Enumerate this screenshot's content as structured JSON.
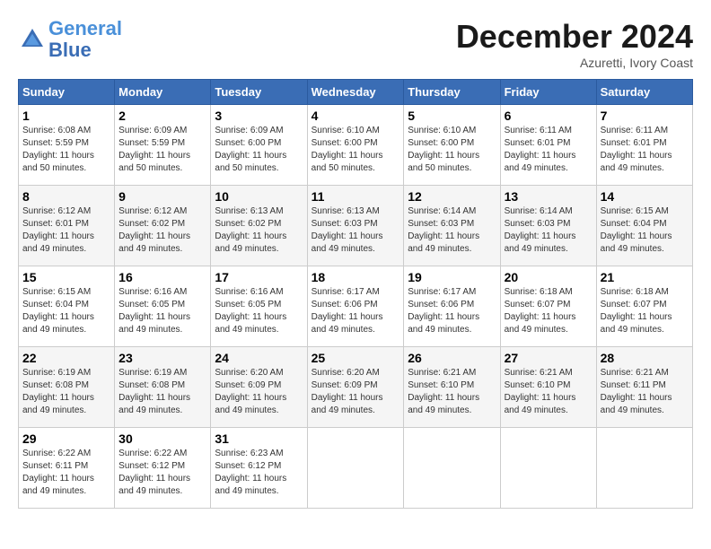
{
  "header": {
    "logo_line1": "General",
    "logo_line2": "Blue",
    "month_title": "December 2024",
    "location": "Azuretti, Ivory Coast"
  },
  "calendar": {
    "weekdays": [
      "Sunday",
      "Monday",
      "Tuesday",
      "Wednesday",
      "Thursday",
      "Friday",
      "Saturday"
    ],
    "weeks": [
      [
        {
          "day": "1",
          "sunrise": "6:08 AM",
          "sunset": "5:59 PM",
          "daylight": "11 hours and 50 minutes."
        },
        {
          "day": "2",
          "sunrise": "6:09 AM",
          "sunset": "5:59 PM",
          "daylight": "11 hours and 50 minutes."
        },
        {
          "day": "3",
          "sunrise": "6:09 AM",
          "sunset": "6:00 PM",
          "daylight": "11 hours and 50 minutes."
        },
        {
          "day": "4",
          "sunrise": "6:10 AM",
          "sunset": "6:00 PM",
          "daylight": "11 hours and 50 minutes."
        },
        {
          "day": "5",
          "sunrise": "6:10 AM",
          "sunset": "6:00 PM",
          "daylight": "11 hours and 50 minutes."
        },
        {
          "day": "6",
          "sunrise": "6:11 AM",
          "sunset": "6:01 PM",
          "daylight": "11 hours and 49 minutes."
        },
        {
          "day": "7",
          "sunrise": "6:11 AM",
          "sunset": "6:01 PM",
          "daylight": "11 hours and 49 minutes."
        }
      ],
      [
        {
          "day": "8",
          "sunrise": "6:12 AM",
          "sunset": "6:01 PM",
          "daylight": "11 hours and 49 minutes."
        },
        {
          "day": "9",
          "sunrise": "6:12 AM",
          "sunset": "6:02 PM",
          "daylight": "11 hours and 49 minutes."
        },
        {
          "day": "10",
          "sunrise": "6:13 AM",
          "sunset": "6:02 PM",
          "daylight": "11 hours and 49 minutes."
        },
        {
          "day": "11",
          "sunrise": "6:13 AM",
          "sunset": "6:03 PM",
          "daylight": "11 hours and 49 minutes."
        },
        {
          "day": "12",
          "sunrise": "6:14 AM",
          "sunset": "6:03 PM",
          "daylight": "11 hours and 49 minutes."
        },
        {
          "day": "13",
          "sunrise": "6:14 AM",
          "sunset": "6:03 PM",
          "daylight": "11 hours and 49 minutes."
        },
        {
          "day": "14",
          "sunrise": "6:15 AM",
          "sunset": "6:04 PM",
          "daylight": "11 hours and 49 minutes."
        }
      ],
      [
        {
          "day": "15",
          "sunrise": "6:15 AM",
          "sunset": "6:04 PM",
          "daylight": "11 hours and 49 minutes."
        },
        {
          "day": "16",
          "sunrise": "6:16 AM",
          "sunset": "6:05 PM",
          "daylight": "11 hours and 49 minutes."
        },
        {
          "day": "17",
          "sunrise": "6:16 AM",
          "sunset": "6:05 PM",
          "daylight": "11 hours and 49 minutes."
        },
        {
          "day": "18",
          "sunrise": "6:17 AM",
          "sunset": "6:06 PM",
          "daylight": "11 hours and 49 minutes."
        },
        {
          "day": "19",
          "sunrise": "6:17 AM",
          "sunset": "6:06 PM",
          "daylight": "11 hours and 49 minutes."
        },
        {
          "day": "20",
          "sunrise": "6:18 AM",
          "sunset": "6:07 PM",
          "daylight": "11 hours and 49 minutes."
        },
        {
          "day": "21",
          "sunrise": "6:18 AM",
          "sunset": "6:07 PM",
          "daylight": "11 hours and 49 minutes."
        }
      ],
      [
        {
          "day": "22",
          "sunrise": "6:19 AM",
          "sunset": "6:08 PM",
          "daylight": "11 hours and 49 minutes."
        },
        {
          "day": "23",
          "sunrise": "6:19 AM",
          "sunset": "6:08 PM",
          "daylight": "11 hours and 49 minutes."
        },
        {
          "day": "24",
          "sunrise": "6:20 AM",
          "sunset": "6:09 PM",
          "daylight": "11 hours and 49 minutes."
        },
        {
          "day": "25",
          "sunrise": "6:20 AM",
          "sunset": "6:09 PM",
          "daylight": "11 hours and 49 minutes."
        },
        {
          "day": "26",
          "sunrise": "6:21 AM",
          "sunset": "6:10 PM",
          "daylight": "11 hours and 49 minutes."
        },
        {
          "day": "27",
          "sunrise": "6:21 AM",
          "sunset": "6:10 PM",
          "daylight": "11 hours and 49 minutes."
        },
        {
          "day": "28",
          "sunrise": "6:21 AM",
          "sunset": "6:11 PM",
          "daylight": "11 hours and 49 minutes."
        }
      ],
      [
        {
          "day": "29",
          "sunrise": "6:22 AM",
          "sunset": "6:11 PM",
          "daylight": "11 hours and 49 minutes."
        },
        {
          "day": "30",
          "sunrise": "6:22 AM",
          "sunset": "6:12 PM",
          "daylight": "11 hours and 49 minutes."
        },
        {
          "day": "31",
          "sunrise": "6:23 AM",
          "sunset": "6:12 PM",
          "daylight": "11 hours and 49 minutes."
        },
        null,
        null,
        null,
        null
      ]
    ]
  }
}
